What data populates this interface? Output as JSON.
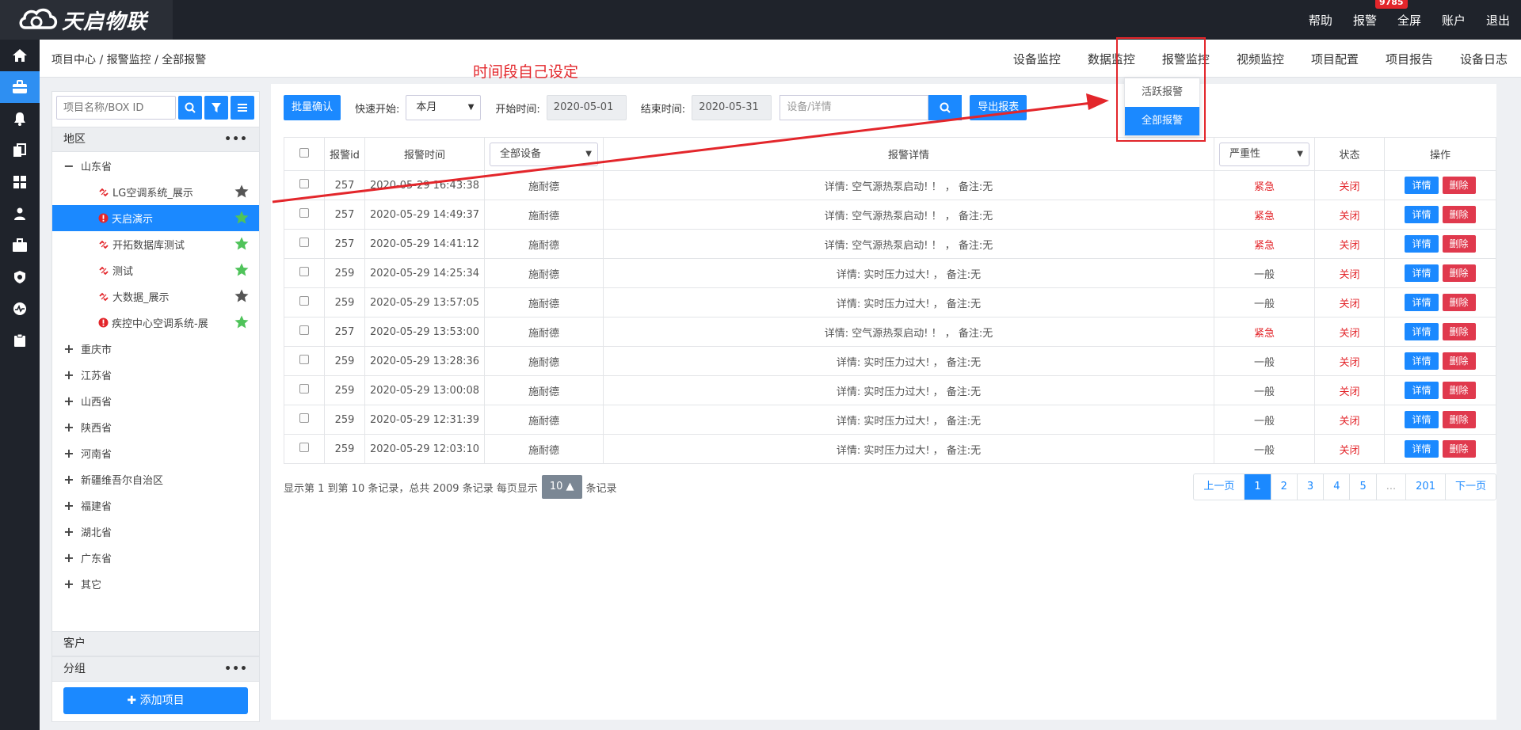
{
  "brand": {
    "logo_text": "天启物联"
  },
  "top_menu": {
    "help": "帮助",
    "alarm": "报警",
    "alarm_badge": "9785",
    "fullscreen": "全屏",
    "account": "账户",
    "logout": "退出"
  },
  "breadcrumb": "项目中心 / 报警监控 / 全部报警",
  "nav_tabs": [
    "设备监控",
    "数据监控",
    "报警监控",
    "视频监控",
    "项目配置",
    "项目报告",
    "设备日志"
  ],
  "annotation": {
    "text": "时间段自己设定",
    "color": "#e3262b"
  },
  "alarm_dropdown": {
    "items": [
      "活跃报警",
      "全部报警"
    ],
    "active": "全部报警"
  },
  "left_panel": {
    "search_placeholder": "项目名称/BOX ID",
    "region_label": "地区",
    "customer_label": "客户",
    "group_label": "分组",
    "more": "•••",
    "add_project": "添加项目",
    "tree": [
      {
        "label": "山东省",
        "expanded": true,
        "children": [
          {
            "label": "LG空调系统_展示",
            "status": "link",
            "star": "gray"
          },
          {
            "label": "天启演示",
            "status": "alert",
            "star": "green",
            "selected": true
          },
          {
            "label": "开拓数据库测试",
            "status": "link",
            "star": "green"
          },
          {
            "label": "测试",
            "status": "link",
            "star": "green"
          },
          {
            "label": "大数据_展示",
            "status": "link",
            "star": "gray"
          },
          {
            "label": "疾控中心空调系统-展",
            "status": "alert",
            "star": "green"
          }
        ]
      },
      {
        "label": "重庆市"
      },
      {
        "label": "江苏省"
      },
      {
        "label": "山西省"
      },
      {
        "label": "陕西省"
      },
      {
        "label": "河南省"
      },
      {
        "label": "新疆维吾尔自治区"
      },
      {
        "label": "福建省"
      },
      {
        "label": "湖北省"
      },
      {
        "label": "广东省"
      },
      {
        "label": "其它"
      }
    ]
  },
  "toolbar": {
    "batch_confirm": "批量确认",
    "quick_start_label": "快速开始:",
    "quick_start_value": "本月",
    "start_label": "开始时间:",
    "start_value": "2020-05-01",
    "end_label": "结束时间:",
    "end_value": "2020-05-31",
    "search_placeholder": "设备/详情",
    "export": "导出报表"
  },
  "table": {
    "headers": {
      "id": "报警id",
      "time": "报警时间",
      "device_filter": "全部设备",
      "detail": "报警详情",
      "severity_filter": "严重性",
      "status": "状态",
      "ops": "操作"
    },
    "detail_btn": "详情",
    "delete_btn": "删除",
    "rows": [
      {
        "id": "257",
        "time": "2020-05-29 16:43:38",
        "device": "施耐德",
        "detail": "详情: 空气源热泵启动! ！ ， 备注:无",
        "severity": "紧急",
        "status": "关闭"
      },
      {
        "id": "257",
        "time": "2020-05-29 14:49:37",
        "device": "施耐德",
        "detail": "详情: 空气源热泵启动! ！ ， 备注:无",
        "severity": "紧急",
        "status": "关闭"
      },
      {
        "id": "257",
        "time": "2020-05-29 14:41:12",
        "device": "施耐德",
        "detail": "详情: 空气源热泵启动! ！ ， 备注:无",
        "severity": "紧急",
        "status": "关闭"
      },
      {
        "id": "259",
        "time": "2020-05-29 14:25:34",
        "device": "施耐德",
        "detail": "详情: 实时压力过大! ， 备注:无",
        "severity": "一般",
        "status": "关闭"
      },
      {
        "id": "259",
        "time": "2020-05-29 13:57:05",
        "device": "施耐德",
        "detail": "详情: 实时压力过大! ， 备注:无",
        "severity": "一般",
        "status": "关闭"
      },
      {
        "id": "257",
        "time": "2020-05-29 13:53:00",
        "device": "施耐德",
        "detail": "详情: 空气源热泵启动! ！ ， 备注:无",
        "severity": "紧急",
        "status": "关闭"
      },
      {
        "id": "259",
        "time": "2020-05-29 13:28:36",
        "device": "施耐德",
        "detail": "详情: 实时压力过大! ， 备注:无",
        "severity": "一般",
        "status": "关闭"
      },
      {
        "id": "259",
        "time": "2020-05-29 13:00:08",
        "device": "施耐德",
        "detail": "详情: 实时压力过大! ， 备注:无",
        "severity": "一般",
        "status": "关闭"
      },
      {
        "id": "259",
        "time": "2020-05-29 12:31:39",
        "device": "施耐德",
        "detail": "详情: 实时压力过大! ， 备注:无",
        "severity": "一般",
        "status": "关闭"
      },
      {
        "id": "259",
        "time": "2020-05-29 12:03:10",
        "device": "施耐德",
        "detail": "详情: 实时压力过大! ， 备注:无",
        "severity": "一般",
        "status": "关闭"
      }
    ]
  },
  "pager": {
    "info_prefix": "显示第 1 到第 10 条记录，总共 2009 条记录 每页显示",
    "page_size": "10",
    "info_suffix": "条记录",
    "prev": "上一页",
    "pages": [
      "1",
      "2",
      "3",
      "4",
      "5",
      "...",
      "201"
    ],
    "active": "1",
    "next": "下一页"
  },
  "colors": {
    "primary": "#1b89ff",
    "danger": "#e3262b",
    "sidebar_bg": "#1f232b"
  }
}
